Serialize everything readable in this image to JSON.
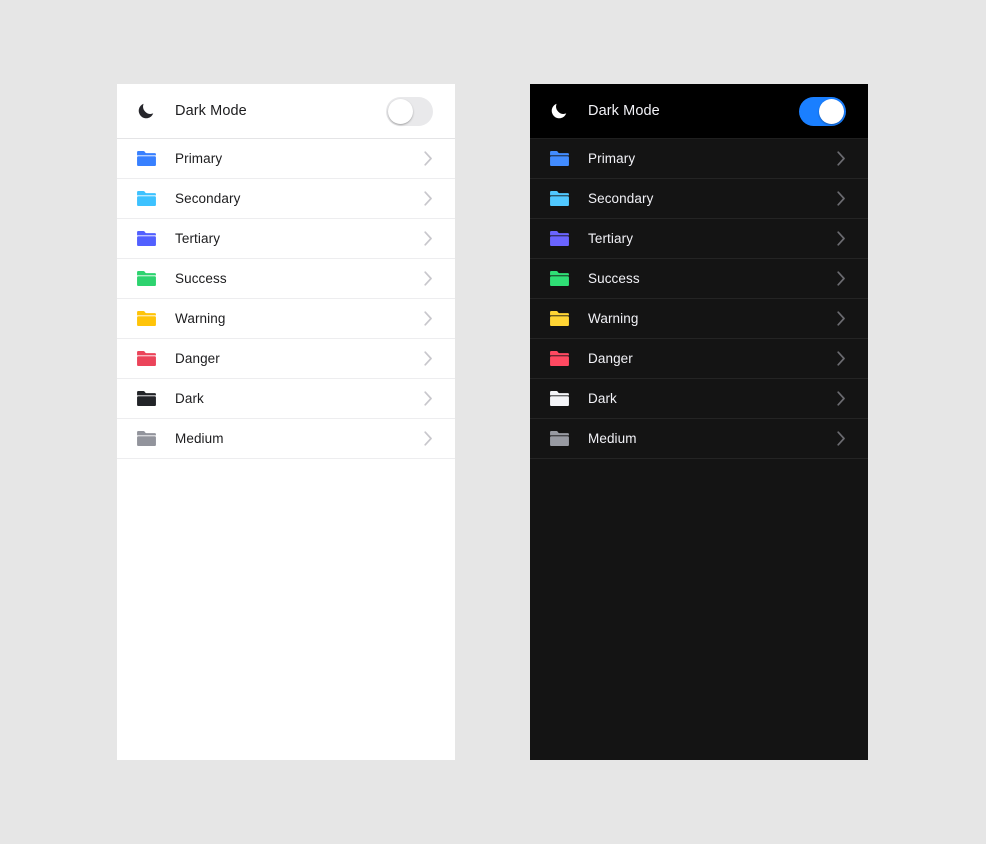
{
  "background_color": "#e6e6e6",
  "panels": [
    {
      "id": "light",
      "theme_name": "light",
      "background": "#ffffff",
      "header": {
        "icon": "moon-icon",
        "label": "Dark Mode",
        "toggle_state": "off",
        "toggle_track_color": "#e9e9eb",
        "toggle_knob_color": "#ffffff"
      },
      "rows": [
        {
          "icon": "folder-icon",
          "label": "Primary",
          "color": "#3880ff",
          "accessory": "chevron-right-icon"
        },
        {
          "icon": "folder-icon",
          "label": "Secondary",
          "color": "#3dc2ff",
          "accessory": "chevron-right-icon"
        },
        {
          "icon": "folder-icon",
          "label": "Tertiary",
          "color": "#5260ff",
          "accessory": "chevron-right-icon"
        },
        {
          "icon": "folder-icon",
          "label": "Success",
          "color": "#2dd36f",
          "accessory": "chevron-right-icon"
        },
        {
          "icon": "folder-icon",
          "label": "Warning",
          "color": "#ffc409",
          "accessory": "chevron-right-icon"
        },
        {
          "icon": "folder-icon",
          "label": "Danger",
          "color": "#eb445a",
          "accessory": "chevron-right-icon"
        },
        {
          "icon": "folder-icon",
          "label": "Dark",
          "color": "#222428",
          "accessory": "chevron-right-icon"
        },
        {
          "icon": "folder-icon",
          "label": "Medium",
          "color": "#92949c",
          "accessory": "chevron-right-icon"
        }
      ]
    },
    {
      "id": "dark",
      "theme_name": "dark",
      "background": "#141414",
      "header": {
        "icon": "moon-icon",
        "label": "Dark Mode",
        "toggle_state": "on",
        "toggle_track_color": "#1a7fff",
        "toggle_knob_color": "#ffffff"
      },
      "rows": [
        {
          "icon": "folder-icon",
          "label": "Primary",
          "color": "#428cff",
          "accessory": "chevron-right-icon"
        },
        {
          "icon": "folder-icon",
          "label": "Secondary",
          "color": "#50c8ff",
          "accessory": "chevron-right-icon"
        },
        {
          "icon": "folder-icon",
          "label": "Tertiary",
          "color": "#6a64ff",
          "accessory": "chevron-right-icon"
        },
        {
          "icon": "folder-icon",
          "label": "Success",
          "color": "#2fdf75",
          "accessory": "chevron-right-icon"
        },
        {
          "icon": "folder-icon",
          "label": "Warning",
          "color": "#ffd534",
          "accessory": "chevron-right-icon"
        },
        {
          "icon": "folder-icon",
          "label": "Danger",
          "color": "#ff4961",
          "accessory": "chevron-right-icon"
        },
        {
          "icon": "folder-icon",
          "label": "Dark",
          "color": "#f4f5f8",
          "accessory": "chevron-right-icon"
        },
        {
          "icon": "folder-icon",
          "label": "Medium",
          "color": "#989aa2",
          "accessory": "chevron-right-icon"
        }
      ]
    }
  ]
}
